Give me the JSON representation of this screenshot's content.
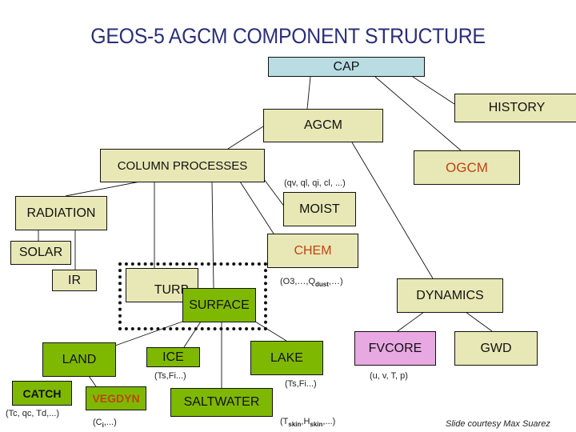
{
  "title": "GEOS-5 AGCM COMPONENT STRUCTURE",
  "colors": {
    "title": "#2b2f78",
    "component_fill": "#e8e8b6",
    "cap_fill": "#b9dde2",
    "surface_fill": "#7fb800",
    "fvcore_fill": "#e8a9e2",
    "highlight_text": "#bf4410"
  },
  "nodes": {
    "cap": "CAP",
    "history": "HISTORY",
    "agcm": "AGCM",
    "column_processes": "COLUMN PROCESSES",
    "ogcm": "OGCM",
    "radiation": "RADIATION",
    "moist": "MOIST",
    "solar": "SOLAR",
    "chem": "CHEM",
    "ir": "IR",
    "turb": "TURB",
    "surface": "SURFACE",
    "dynamics": "DYNAMICS",
    "land": "LAND",
    "ice": "ICE",
    "lake": "LAKE",
    "fvcore": "FVCORE",
    "gwd": "GWD",
    "catch": "CATCH",
    "vegdyn": "VEGDYN",
    "saltwater": "SALTWATER"
  },
  "notes": {
    "moist_vars": "(qv, ql, qi, cl, ...)",
    "chem_vars": {
      "pre": "(O3,…,Q",
      "sub": "dust",
      "post": ",…)"
    },
    "ice_vars": "(Ts,Fi...)",
    "lake_vars": "(Ts,Fi...)",
    "catch_vars": "(Tc, qc, Td,...)",
    "vegdyn_vars": {
      "pre": "(C",
      "sub": "i",
      "post": ",...)"
    },
    "saltwater_vars": {
      "pre": "(T",
      "sub1": "skin",
      "mid": ",H",
      "sub2": "skin",
      "post": ",...)"
    },
    "fvcore_vars": "(u, v, T, p)"
  },
  "credit": "Slide courtesy Max Suarez",
  "edges": [
    [
      "cap",
      "agcm"
    ],
    [
      "cap",
      "history"
    ],
    [
      "cap",
      "ogcm"
    ],
    [
      "agcm",
      "column_processes"
    ],
    [
      "agcm",
      "dynamics"
    ],
    [
      "column_processes",
      "radiation"
    ],
    [
      "column_processes",
      "turb"
    ],
    [
      "column_processes",
      "surface"
    ],
    [
      "column_processes",
      "chem"
    ],
    [
      "column_processes",
      "moist"
    ],
    [
      "radiation",
      "solar"
    ],
    [
      "radiation",
      "ir"
    ],
    [
      "surface",
      "land"
    ],
    [
      "surface",
      "ice"
    ],
    [
      "surface",
      "saltwater"
    ],
    [
      "surface",
      "lake"
    ],
    [
      "land",
      "catch"
    ],
    [
      "land",
      "vegdyn"
    ],
    [
      "dynamics",
      "fvcore"
    ],
    [
      "dynamics",
      "gwd"
    ]
  ]
}
